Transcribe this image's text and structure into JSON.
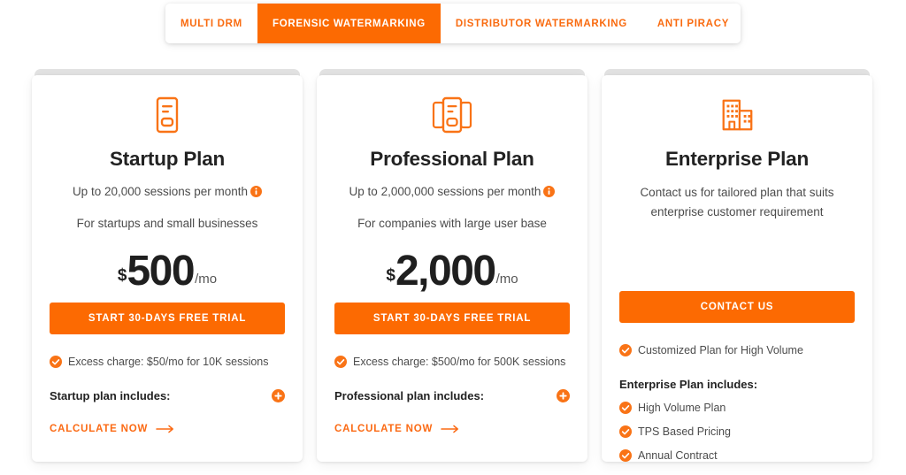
{
  "tabs": {
    "items": [
      {
        "label": "MULTI DRM",
        "active": false
      },
      {
        "label": "FORENSIC WATERMARKING",
        "active": true
      },
      {
        "label": "DISTRIBUTOR WATERMARKING",
        "active": false
      },
      {
        "label": "ANTI PIRACY",
        "active": false
      }
    ]
  },
  "colors": {
    "accent": "#fc6a02",
    "accent_text": "#f96b10",
    "card_band": "#e2e2e2",
    "heading": "#222222",
    "body_text": "#4c4c4c"
  },
  "plans": [
    {
      "icon": "server-rack-single-icon",
      "title": "Startup Plan",
      "sessions": "Up to 20,000 sessions per month",
      "sessions_info_icon": "info-circle-icon",
      "description": "For startups and small businesses",
      "currency": "$",
      "amount": "500",
      "period": "/mo",
      "cta_label": "START 30-DAYS FREE TRIAL",
      "excess": "Excess charge: $50/mo for 10K sessions",
      "includes_title": "Startup plan includes:",
      "expand_icon": "plus-circle-icon",
      "calculate_label": "CALCULATE NOW",
      "calculate_arrow_icon": "arrow-right-icon",
      "features": []
    },
    {
      "icon": "server-rack-triple-icon",
      "title": "Professional Plan",
      "sessions": "Up to 2,000,000 sessions per month",
      "sessions_info_icon": "info-circle-icon",
      "description": "For companies with large user base",
      "currency": "$",
      "amount": "2,000",
      "period": "/mo",
      "cta_label": "START 30-DAYS FREE TRIAL",
      "excess": "Excess charge: $500/mo for 500K sessions",
      "includes_title": "Professional plan includes:",
      "expand_icon": "plus-circle-icon",
      "calculate_label": "CALCULATE NOW",
      "calculate_arrow_icon": "arrow-right-icon",
      "features": []
    },
    {
      "icon": "office-building-icon",
      "title": "Enterprise Plan",
      "description_line1": "Contact us for tailored plan that suits",
      "description_line2": "enterprise customer requirement",
      "cta_label": "CONTACT US",
      "excess": "Customized Plan for High Volume",
      "includes_title": "Enterprise Plan includes:",
      "features": [
        "High Volume Plan",
        "TPS Based Pricing",
        "Annual Contract"
      ]
    }
  ]
}
